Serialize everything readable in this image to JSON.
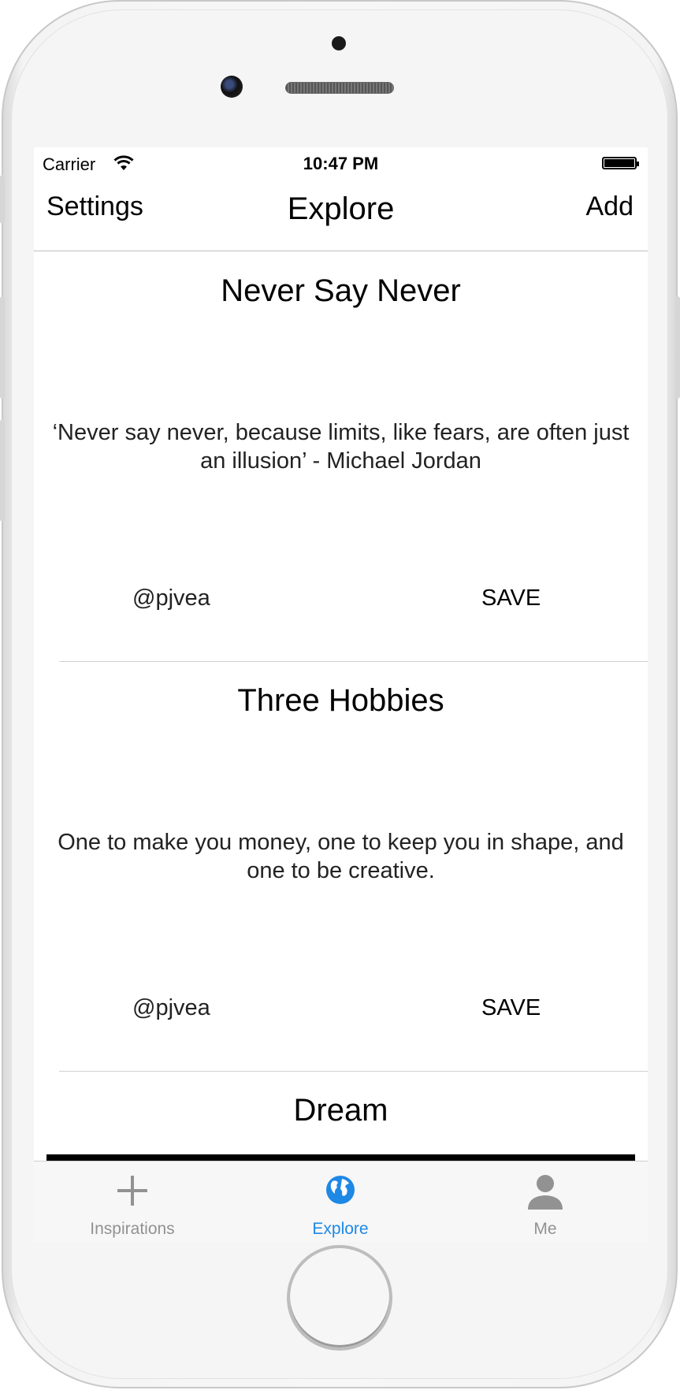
{
  "status_bar": {
    "carrier": "Carrier",
    "time": "10:47 PM"
  },
  "nav": {
    "left": "Settings",
    "title": "Explore",
    "right": "Add"
  },
  "cards": [
    {
      "title": "Never Say Never",
      "body": "‘Never say never, because limits, like fears, are often just an illusion’ - Michael Jordan",
      "author": "@pjvea",
      "action": "SAVE"
    },
    {
      "title": "Three Hobbies",
      "body": "One to make you money, one to keep you in shape, and one to be creative.",
      "author": "@pjvea",
      "action": "SAVE"
    },
    {
      "title": "Dream"
    }
  ],
  "tabs": [
    {
      "label": "Inspirations",
      "icon": "plus-icon",
      "active": false
    },
    {
      "label": "Explore",
      "icon": "globe-icon",
      "active": true
    },
    {
      "label": "Me",
      "icon": "person-icon",
      "active": false
    }
  ],
  "colors": {
    "accent": "#1e88e5",
    "tab_inactive": "#929292"
  }
}
